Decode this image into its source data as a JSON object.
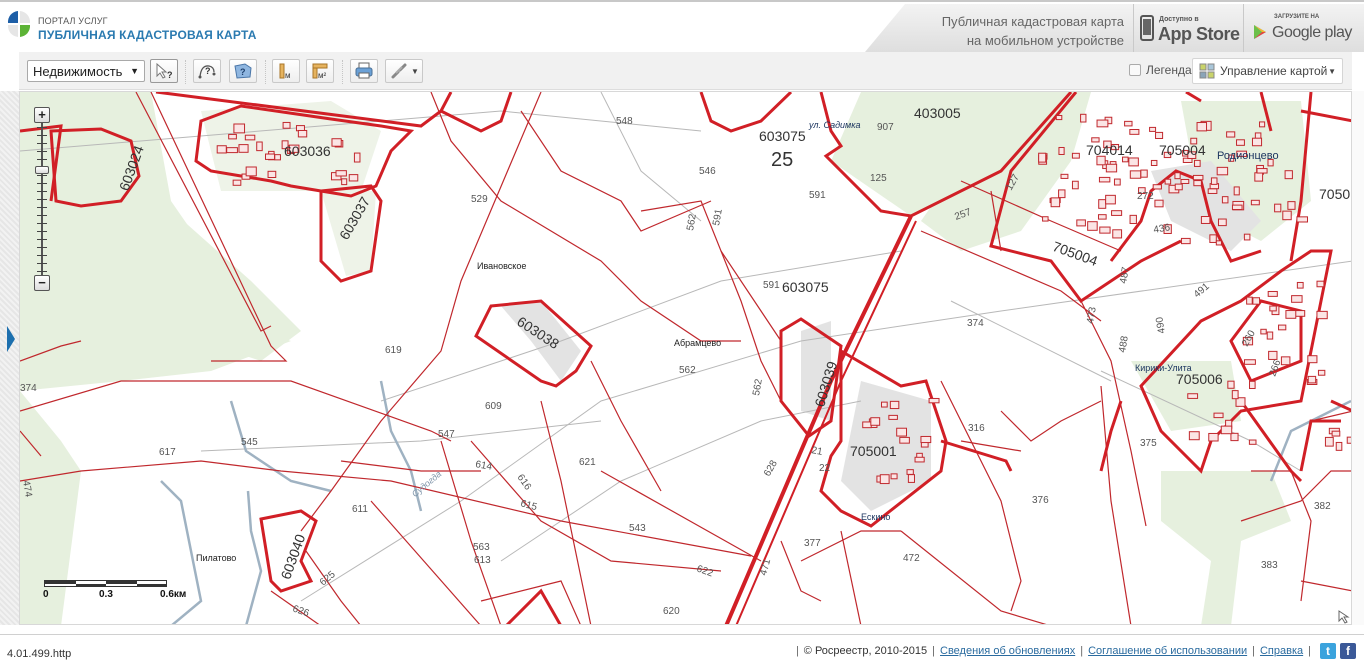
{
  "header": {
    "portal_subtitle": "ПОРТАЛ УСЛУГ",
    "portal_title": "ПУБЛИЧНАЯ КАДАСТРОВАЯ КАРТА",
    "promo_line1": "Публичная кадастровая карта",
    "promo_line2": "на мобильном устройстве",
    "appstore_small": "Доступно в",
    "appstore_big": "App Store",
    "googleplay_small": "ЗАГРУЗИТЕ НА",
    "googleplay_big": "Google play"
  },
  "toolbar": {
    "layer_select_value": "Недвижимость",
    "legend_label": "Легенда",
    "legend_checked": false,
    "map_control_label": "Управление картой",
    "tools": [
      {
        "name": "identify-tool",
        "icon": "cursor-question-icon"
      },
      {
        "name": "identify-line-tool",
        "icon": "curve-question-icon"
      },
      {
        "name": "identify-polygon-tool",
        "icon": "polygon-question-icon"
      },
      {
        "name": "measure-distance-tool",
        "icon": "ruler-m-icon"
      },
      {
        "name": "measure-area-tool",
        "icon": "ruler-m2-icon"
      },
      {
        "name": "print-tool",
        "icon": "printer-icon"
      },
      {
        "name": "link-tool",
        "icon": "chain-link-icon"
      }
    ]
  },
  "map": {
    "zoom_buttons": {
      "plus": "+",
      "minus": "−"
    },
    "zoom_level_fraction": 0.28,
    "scale": {
      "labels": [
        "0",
        "0.3",
        "0.6км"
      ]
    },
    "quarters": [
      {
        "id": "603036",
        "label": "603036"
      },
      {
        "id": "603037",
        "label": "603037"
      },
      {
        "id": "603024",
        "label": "603024"
      },
      {
        "id": "603038",
        "label": "603038"
      },
      {
        "id": "603039",
        "label": "603039"
      },
      {
        "id": "603040",
        "label": "603040"
      },
      {
        "id": "603075a",
        "label": "603075"
      },
      {
        "id": "603075b",
        "label": "603075"
      },
      {
        "id": "403005",
        "label": "403005"
      },
      {
        "id": "704014",
        "label": "704014"
      },
      {
        "id": "705004a",
        "label": "705004"
      },
      {
        "id": "705004b",
        "label": "705004"
      },
      {
        "id": "705006",
        "label": "705006"
      },
      {
        "id": "705001",
        "label": "705001"
      },
      {
        "id": "705005",
        "label": "7050"
      },
      {
        "id": "district25",
        "label": "25"
      }
    ],
    "parcels": [
      "548",
      "546",
      "529",
      "591",
      "591",
      "591",
      "562",
      "562",
      "562",
      "907",
      "125",
      "257",
      "127",
      "272",
      "436",
      "487",
      "491",
      "490",
      "473",
      "488",
      "374",
      "374",
      "316",
      "619",
      "609",
      "547",
      "621",
      "614",
      "616",
      "615",
      "543",
      "563",
      "613",
      "617",
      "545",
      "611",
      "625",
      "626",
      "622",
      "620",
      "628",
      "471",
      "21",
      "22",
      "377",
      "472",
      "376",
      "375",
      "383",
      "382",
      "266",
      "260",
      "474"
    ],
    "places": [
      "Ивановское",
      "Абрамцево",
      "Родионцево",
      "Кирики-Улита",
      "Пилатово",
      "Ескино"
    ],
    "streets": [
      "ул. Садимка"
    ],
    "rivers": [
      "Судогда"
    ]
  },
  "footer": {
    "version": "4.01.499.http",
    "copyright": "© Росреестр, 2010-2015",
    "links": [
      "Сведения об обновлениях",
      "Соглашение об использовании",
      "Справка"
    ],
    "social": [
      "twitter-icon",
      "facebook-icon"
    ]
  }
}
